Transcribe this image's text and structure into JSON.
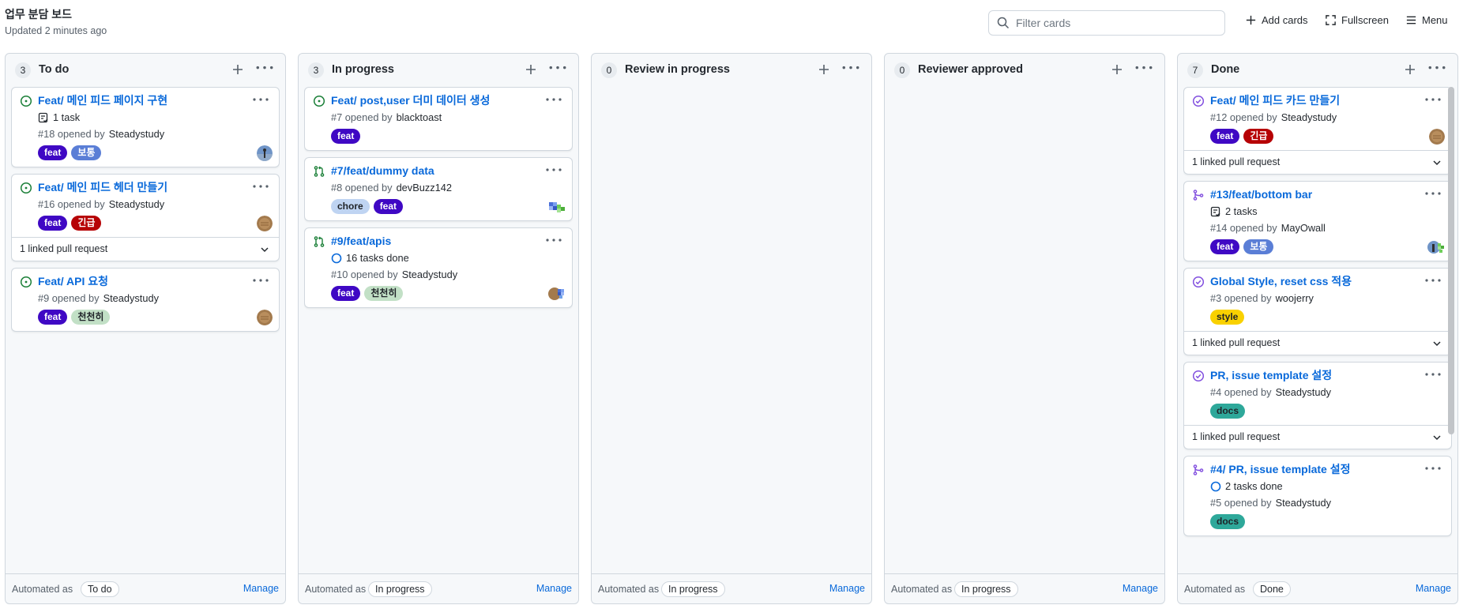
{
  "header": {
    "title": "업무 분담 보드",
    "updated": "Updated 2 minutes ago",
    "filter_placeholder": "Filter cards",
    "add_cards": "Add cards",
    "fullscreen": "Fullscreen",
    "menu": "Menu"
  },
  "footer_common": {
    "automated_as": "Automated as",
    "manage": "Manage"
  },
  "columns": [
    {
      "count": "3",
      "name": "To do",
      "automation": "To do",
      "cards": [
        {
          "type": "issue-open",
          "title": "Feat/ 메인 피드 페이지 구현",
          "tasks": "1 task",
          "opened": "#18 opened by",
          "author": "Steadystudy",
          "labels": [
            {
              "text": "feat",
              "bg": "#3f08c4",
              "fg": "#ffffff"
            },
            {
              "text": "보통",
              "bg": "#5a7ed6",
              "fg": "#ffffff"
            }
          ],
          "avatar": "person"
        },
        {
          "type": "issue-open",
          "title": "Feat/ 메인 피드 헤더 만들기",
          "opened": "#16 opened by",
          "author": "Steadystudy",
          "labels": [
            {
              "text": "feat",
              "bg": "#3f08c4",
              "fg": "#ffffff"
            },
            {
              "text": "긴급",
              "bg": "#b60205",
              "fg": "#ffffff"
            }
          ],
          "avatar": "brown",
          "linked": "1 linked pull request"
        },
        {
          "type": "issue-open",
          "title": "Feat/ API 요청",
          "opened": "#9 opened by",
          "author": "Steadystudy",
          "labels": [
            {
              "text": "feat",
              "bg": "#3f08c4",
              "fg": "#ffffff"
            },
            {
              "text": "천천히",
              "bg": "#c2e0c6",
              "fg": "#1f2328"
            }
          ],
          "avatar": "brown"
        }
      ]
    },
    {
      "count": "3",
      "name": "In progress",
      "automation": "In progress",
      "cards": [
        {
          "type": "issue-open",
          "title": "Feat/ post,user 더미 데이터 생성",
          "opened": "#7 opened by",
          "author": "blacktoast",
          "labels": [
            {
              "text": "feat",
              "bg": "#3f08c4",
              "fg": "#ffffff"
            }
          ],
          "avatar": "none"
        },
        {
          "type": "pr-open",
          "title": "#7/feat/dummy data",
          "opened": "#8 opened by",
          "author": "devBuzz142",
          "labels": [
            {
              "text": "chore",
              "bg": "#bfd4f2",
              "fg": "#1f2328"
            },
            {
              "text": "feat",
              "bg": "#3f08c4",
              "fg": "#ffffff"
            }
          ],
          "avatar": "pixel"
        },
        {
          "type": "pr-open",
          "title": "#9/feat/apis",
          "tasks_done": "16 tasks done",
          "opened": "#10 opened by",
          "author": "Steadystudy",
          "labels": [
            {
              "text": "feat",
              "bg": "#3f08c4",
              "fg": "#ffffff"
            },
            {
              "text": "천천히",
              "bg": "#c2e0c6",
              "fg": "#1f2328"
            }
          ],
          "avatar": "double"
        }
      ]
    },
    {
      "count": "0",
      "name": "Review in progress",
      "automation": "In progress",
      "cards": []
    },
    {
      "count": "0",
      "name": "Reviewer approved",
      "automation": "In progress",
      "cards": []
    },
    {
      "count": "7",
      "name": "Done",
      "automation": "Done",
      "cards": [
        {
          "type": "issue-closed",
          "title": "Feat/ 메인 피드 카드 만들기",
          "opened": "#12 opened by",
          "author": "Steadystudy",
          "labels": [
            {
              "text": "feat",
              "bg": "#3f08c4",
              "fg": "#ffffff"
            },
            {
              "text": "긴급",
              "bg": "#b60205",
              "fg": "#ffffff"
            }
          ],
          "avatar": "brown",
          "linked": "1 linked pull request"
        },
        {
          "type": "pr-merged",
          "title": "#13/feat/bottom bar",
          "tasks": "2 tasks",
          "opened": "#14 opened by",
          "author": "MayOwall",
          "labels": [
            {
              "text": "feat",
              "bg": "#3f08c4",
              "fg": "#ffffff"
            },
            {
              "text": "보통",
              "bg": "#5a7ed6",
              "fg": "#ffffff"
            }
          ],
          "avatar": "double2"
        },
        {
          "type": "issue-closed",
          "title": "Global Style, reset css 적용",
          "opened": "#3 opened by",
          "author": "woojerry",
          "labels": [
            {
              "text": "style",
              "bg": "#f9d100",
              "fg": "#1f2328"
            }
          ],
          "avatar": "none",
          "linked": "1 linked pull request"
        },
        {
          "type": "issue-closed",
          "title": "PR, issue template 설정",
          "opened": "#4 opened by",
          "author": "Steadystudy",
          "labels": [
            {
              "text": "docs",
              "bg": "#2ea89a",
              "fg": "#1f2328"
            }
          ],
          "avatar": "none",
          "linked": "1 linked pull request"
        },
        {
          "type": "pr-merged",
          "title": "#4/ PR, issue template 설정",
          "tasks_done": "2 tasks done",
          "opened": "#5 opened by",
          "author": "Steadystudy",
          "labels": [
            {
              "text": "docs",
              "bg": "#2ea89a",
              "fg": "#1f2328"
            }
          ],
          "avatar": "none"
        }
      ]
    }
  ],
  "colors": {
    "accent": "#0969da",
    "open": "#1a7f37",
    "merged": "#8250df",
    "border": "#d0d7de"
  }
}
